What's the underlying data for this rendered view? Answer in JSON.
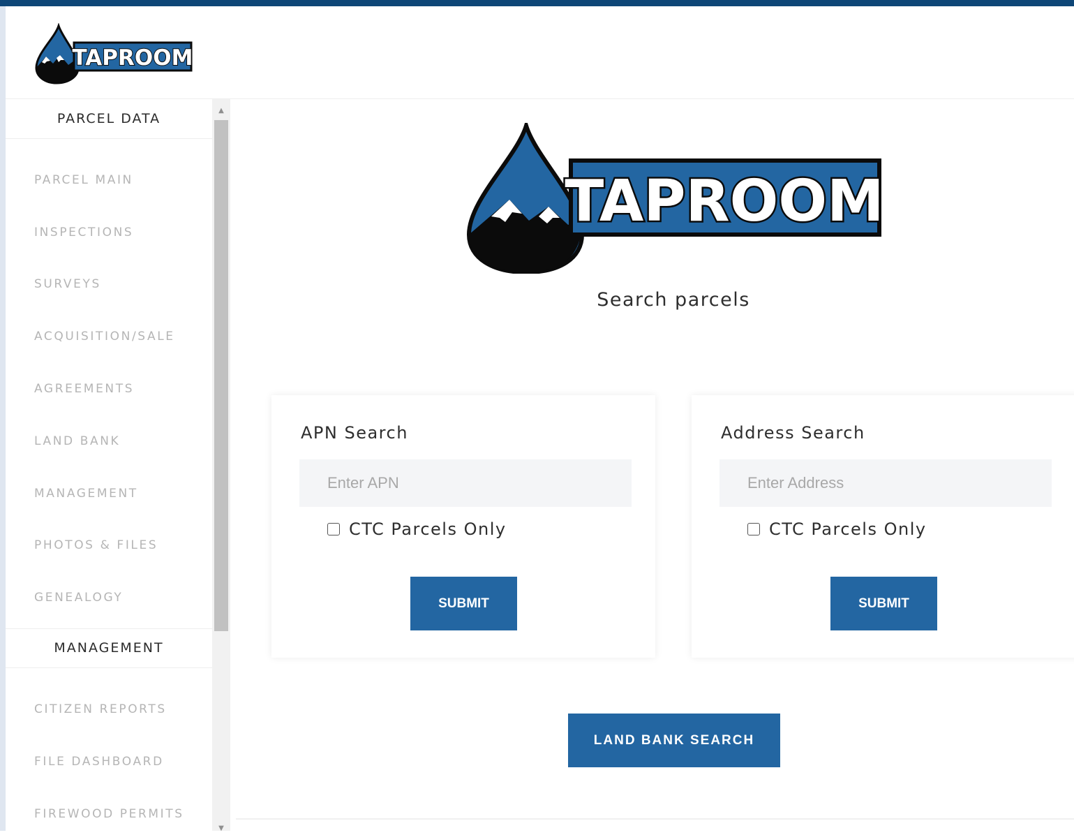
{
  "colors": {
    "top_bar": "#0e4677",
    "accent": "#2366a2",
    "logo_blue": "#2366a2",
    "logo_dark": "#0b0b0b"
  },
  "header": {
    "logo_text": "TAPROOM"
  },
  "sidebar": {
    "sections": [
      {
        "title": "PARCEL DATA",
        "items": [
          {
            "label": "PARCEL MAIN"
          },
          {
            "label": "INSPECTIONS"
          },
          {
            "label": "SURVEYS"
          },
          {
            "label": "ACQUISITION/SALE"
          },
          {
            "label": "AGREEMENTS"
          },
          {
            "label": "LAND BANK"
          },
          {
            "label": "MANAGEMENT"
          },
          {
            "label": "PHOTOS & FILES"
          },
          {
            "label": "GENEALOGY"
          }
        ]
      },
      {
        "title": "MANAGEMENT",
        "items": [
          {
            "label": "CITIZEN REPORTS"
          },
          {
            "label": "FILE DASHBOARD"
          },
          {
            "label": "FIREWOOD PERMITS"
          }
        ]
      }
    ]
  },
  "main": {
    "logo_text": "TAPROOM",
    "subtitle": "Search parcels",
    "apn_card": {
      "title": "APN Search",
      "placeholder": "Enter APN",
      "checkbox_label": "CTC Parcels Only",
      "submit_label": "SUBMIT"
    },
    "address_card": {
      "title": "Address Search",
      "placeholder": "Enter Address",
      "checkbox_label": "CTC Parcels Only",
      "submit_label": "SUBMIT"
    },
    "land_bank_button": "LAND BANK SEARCH"
  }
}
